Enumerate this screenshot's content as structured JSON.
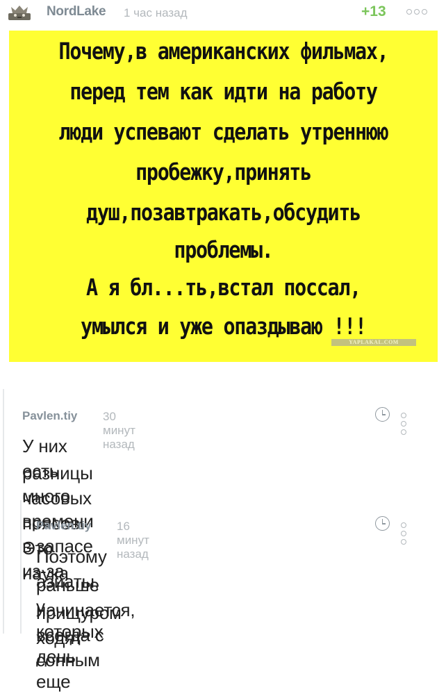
{
  "post": {
    "author": "NordLake",
    "time": "1 час назад",
    "score": "+13",
    "meme": {
      "lines": [
        "Почему,в американских фильмах,",
        "перед тем как идти на работу",
        "люди успевают сделать утреннюю",
        "пробежку,принять",
        "душ,позавтракать,обсудить",
        "проблемы.",
        "А я бл...ть,встал поссал,",
        "умылся и уже опаздываю !!!"
      ],
      "watermark": "YAPLAKAL.COM",
      "background": "#ffff33"
    }
  },
  "comments": [
    {
      "author": "Pavlen.tiy",
      "time": "30 минут назад",
      "text_lines": [
        "У них есть много времени в запасе из-за",
        "разницы часовых поясов. Это наука"
      ]
    },
    {
      "author": "Pavlen.tiy",
      "time": "16 минут назад",
      "text_lines": [
        "Поэтому азиаты, у которых день еще",
        "раньше начинается, всегда с сонным",
        "прищуром ходят"
      ]
    }
  ],
  "icons": {
    "avatar": "avatar-icon",
    "more": "more-dots-icon",
    "clock": "clock-icon"
  },
  "colors": {
    "score_positive": "#7bc55b",
    "username": "#7e8a93",
    "meta": "#b3b8bc"
  }
}
